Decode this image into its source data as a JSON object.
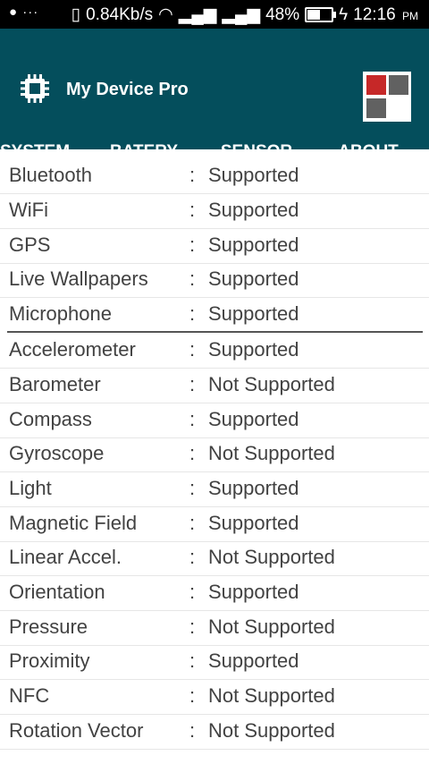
{
  "status_bar": {
    "speed": "0.84Kb/s",
    "battery": "48%",
    "time": "12:16",
    "ampm": "PM",
    "icons": [
      "android-icon",
      "more-icon",
      "vibrate-icon",
      "wifi-icon",
      "signal-icon",
      "signal-icon",
      "battery-icon",
      "charging-icon"
    ]
  },
  "app": {
    "title": "My Device Pro"
  },
  "tabs": [
    {
      "label": "SYSTEM",
      "active": false
    },
    {
      "label": "BATERY",
      "active": false
    },
    {
      "label": "SENSOR",
      "active": true
    },
    {
      "label": "ABOUT",
      "active": false
    }
  ],
  "rows": [
    {
      "name": "Bluetooth",
      "value": "Supported"
    },
    {
      "name": "WiFi",
      "value": "Supported"
    },
    {
      "name": "GPS",
      "value": "Supported"
    },
    {
      "name": "Live Wallpapers",
      "value": "Supported"
    },
    {
      "name": "Microphone",
      "value": "Supported"
    },
    {
      "name": "Accelerometer",
      "value": "Supported"
    },
    {
      "name": "Barometer",
      "value": "Not Supported"
    },
    {
      "name": "Compass",
      "value": "Supported"
    },
    {
      "name": "Gyroscope",
      "value": "Not Supported"
    },
    {
      "name": "Light",
      "value": "Supported"
    },
    {
      "name": "Magnetic Field",
      "value": "Supported"
    },
    {
      "name": "Linear Accel.",
      "value": "Not Supported"
    },
    {
      "name": "Orientation",
      "value": "Supported"
    },
    {
      "name": "Pressure",
      "value": "Not Supported"
    },
    {
      "name": "Proximity",
      "value": "Supported"
    },
    {
      "name": "NFC",
      "value": "Not Supported"
    },
    {
      "name": "Rotation Vector",
      "value": "Not Supported"
    }
  ],
  "separator": ":",
  "colors": {
    "appbar": "#044e5c",
    "logo_red": "#c62828",
    "logo_gray": "#616161"
  }
}
